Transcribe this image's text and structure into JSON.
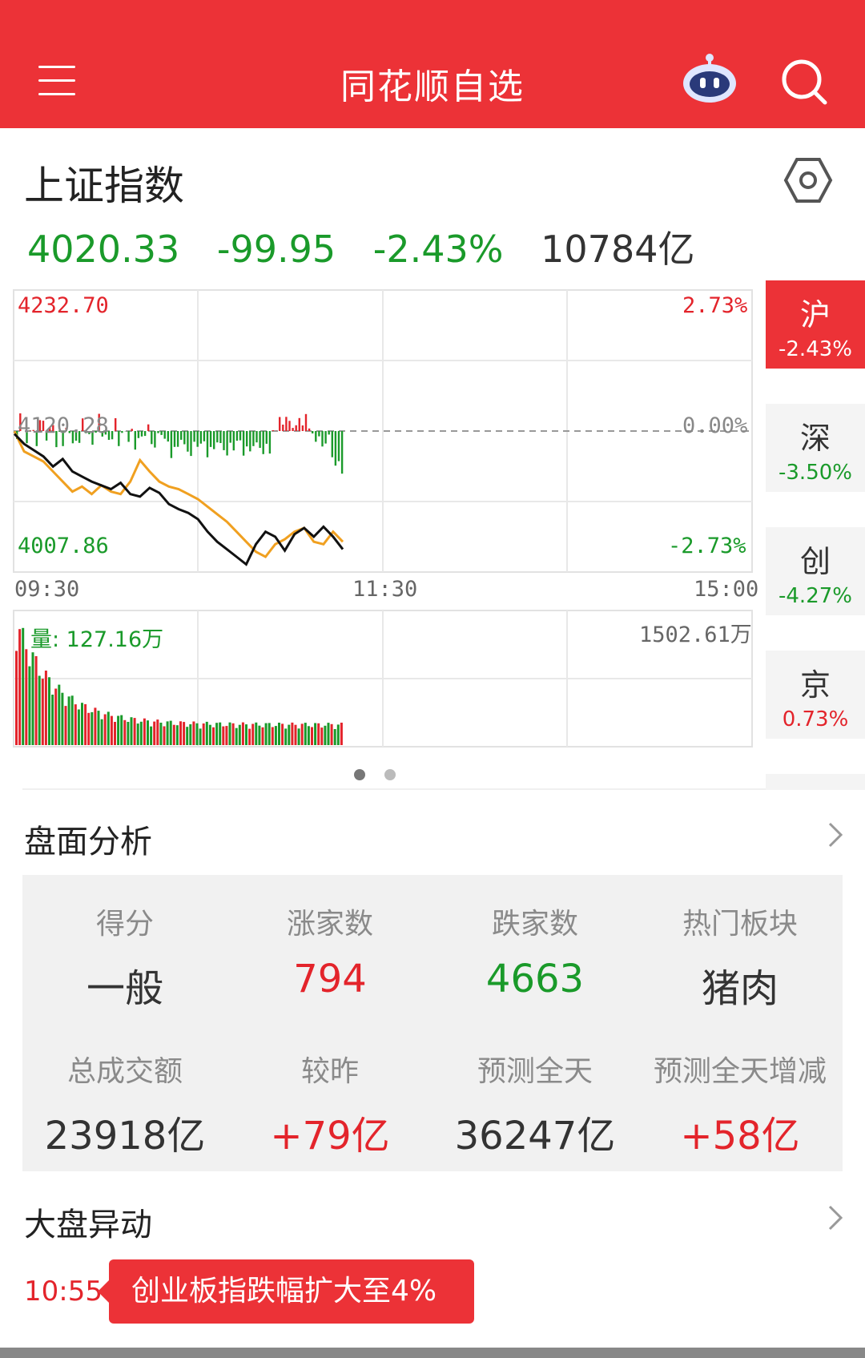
{
  "header": {
    "title": "同花顺自选",
    "menu_icon": "hamburger-icon",
    "robot_icon": "robot-assistant-icon",
    "search_icon": "search-icon"
  },
  "index": {
    "name": "上证指数",
    "price": "4020.33",
    "change": "-99.95",
    "change_pct": "-2.43%",
    "turnover": "10784亿"
  },
  "chart_data": {
    "type": "line",
    "y_labels": {
      "top_left": "4232.70",
      "mid_left": "4120.28",
      "bottom_left": "4007.86",
      "top_right": "2.73%",
      "mid_right": "0.00%",
      "bottom_right": "-2.73%"
    },
    "x_ticks": [
      "09:30",
      "11:30",
      "15:00"
    ],
    "ylim": [
      4007.86,
      4232.7
    ],
    "colors": {
      "index": "#111111",
      "avg": "#f0a020",
      "up": "#e3242b",
      "down": "#1a9a2a"
    },
    "series": [
      {
        "values": [
          4118,
          4110,
          4105,
          4100,
          4092,
          4098,
          4088,
          4084,
          4080,
          4077,
          4074,
          4079,
          4070,
          4068,
          4075,
          4071,
          4062,
          4058,
          4055,
          4050,
          4040,
          4032,
          4026,
          4020,
          4014,
          4030,
          4040,
          4036,
          4025,
          4038,
          4043,
          4036,
          4044,
          4036,
          4026
        ]
      },
      {
        "values": [
          4120,
          4104,
          4100,
          4096,
          4088,
          4080,
          4072,
          4076,
          4070,
          4077,
          4072,
          4070,
          4080,
          4097,
          4088,
          4080,
          4076,
          4074,
          4070,
          4066,
          4060,
          4054,
          4048,
          4040,
          4032,
          4024,
          4020,
          4030,
          4034,
          4040,
          4043,
          4032,
          4030,
          4040,
          4032
        ]
      }
    ],
    "volume": {
      "label": "量: 127.16万",
      "max_label": "1502.61万"
    }
  },
  "market_tabs": [
    {
      "name": "沪",
      "pct": "-2.43%",
      "color": "#ffffff"
    },
    {
      "name": "深",
      "pct": "-3.50%",
      "color": "#1a9a2a"
    },
    {
      "name": "创",
      "pct": "-4.27%",
      "color": "#1a9a2a"
    },
    {
      "name": "京",
      "pct": "0.73%",
      "color": "#e3242b"
    }
  ],
  "analysis": {
    "title": "盘面分析",
    "row1": [
      {
        "label": "得分",
        "value": "一般"
      },
      {
        "label": "涨家数",
        "value": "794"
      },
      {
        "label": "跌家数",
        "value": "4663"
      },
      {
        "label": "热门板块",
        "value": "猪肉"
      }
    ],
    "row2": [
      {
        "label": "总成交额",
        "value": "23918亿"
      },
      {
        "label": "较昨",
        "value": "+79亿"
      },
      {
        "label": "预测全天",
        "value": "36247亿"
      },
      {
        "label": "预测全天增减",
        "value": "+58亿"
      }
    ]
  },
  "market_moves": {
    "title": "大盘异动",
    "time": "10:55",
    "text": "创业板指跌幅扩大至4%"
  }
}
